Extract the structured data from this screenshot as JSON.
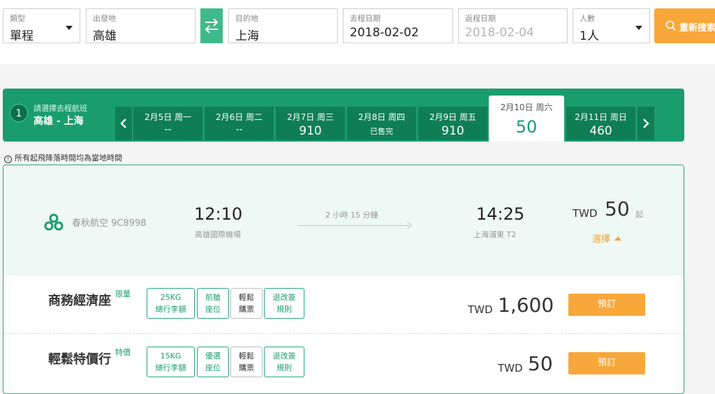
{
  "search": {
    "type": {
      "label": "類型",
      "value": "單程"
    },
    "origin": {
      "label": "出發地",
      "value": "高雄"
    },
    "destination": {
      "label": "目的地",
      "value": "上海"
    },
    "depart_date": {
      "label": "去程日期",
      "value": "2018-02-02"
    },
    "return_date": {
      "label": "返程日期",
      "value": "2018-02-04"
    },
    "passengers": {
      "label": "人數",
      "value": "1人"
    },
    "search_button": "重新搜索"
  },
  "date_strip": {
    "step_number": "1",
    "hint": "請選擇去程航班",
    "route": "高雄 - 上海",
    "days": [
      {
        "date": "2月5日 周一",
        "price": "--"
      },
      {
        "date": "2月6日 周二",
        "price": "--"
      },
      {
        "date": "2月7日 周三",
        "price": "910"
      },
      {
        "date": "2月8日 周四",
        "price": "已售完"
      },
      {
        "date": "2月9日 周五",
        "price": "910"
      },
      {
        "date": "2月10日 周六",
        "price": "50"
      },
      {
        "date": "2月11日 周日",
        "price": "460"
      }
    ],
    "selected_index": 5
  },
  "timezone_note": "所有起飛降落時間均為當地時間",
  "flight": {
    "airline": "春秋航空 9C8998",
    "depart_time": "12:10",
    "depart_airport": "高雄國際機場",
    "duration": "2 小時 15 分鐘",
    "arrive_time": "14:25",
    "arrive_airport": "上海浦東 T2",
    "currency": "TWD",
    "price_from": "50",
    "from_suffix": "起",
    "select_label": "選擇",
    "fares": [
      {
        "name": "商務經濟座",
        "tag": "限量",
        "features": [
          {
            "line1": "25KG",
            "line2": "總行李額"
          },
          {
            "line1": "前艙",
            "line2": "座位"
          },
          {
            "line1": "輕鬆",
            "line2": "購票"
          },
          {
            "line1": "退改簽",
            "line2": "規則"
          }
        ],
        "currency": "TWD",
        "price": "1,600",
        "book_label": "預訂"
      },
      {
        "name": "輕鬆特價行",
        "tag": "特價",
        "features": [
          {
            "line1": "15KG",
            "line2": "總行李額"
          },
          {
            "line1": "優選",
            "line2": "座位"
          },
          {
            "line1": "輕鬆",
            "line2": "購票"
          },
          {
            "line1": "退改簽",
            "line2": "規則"
          }
        ],
        "currency": "TWD",
        "price": "50",
        "book_label": "預訂"
      }
    ]
  },
  "colors": {
    "brand_green": "#1a9d6e",
    "accent_orange": "#f8a73b"
  }
}
